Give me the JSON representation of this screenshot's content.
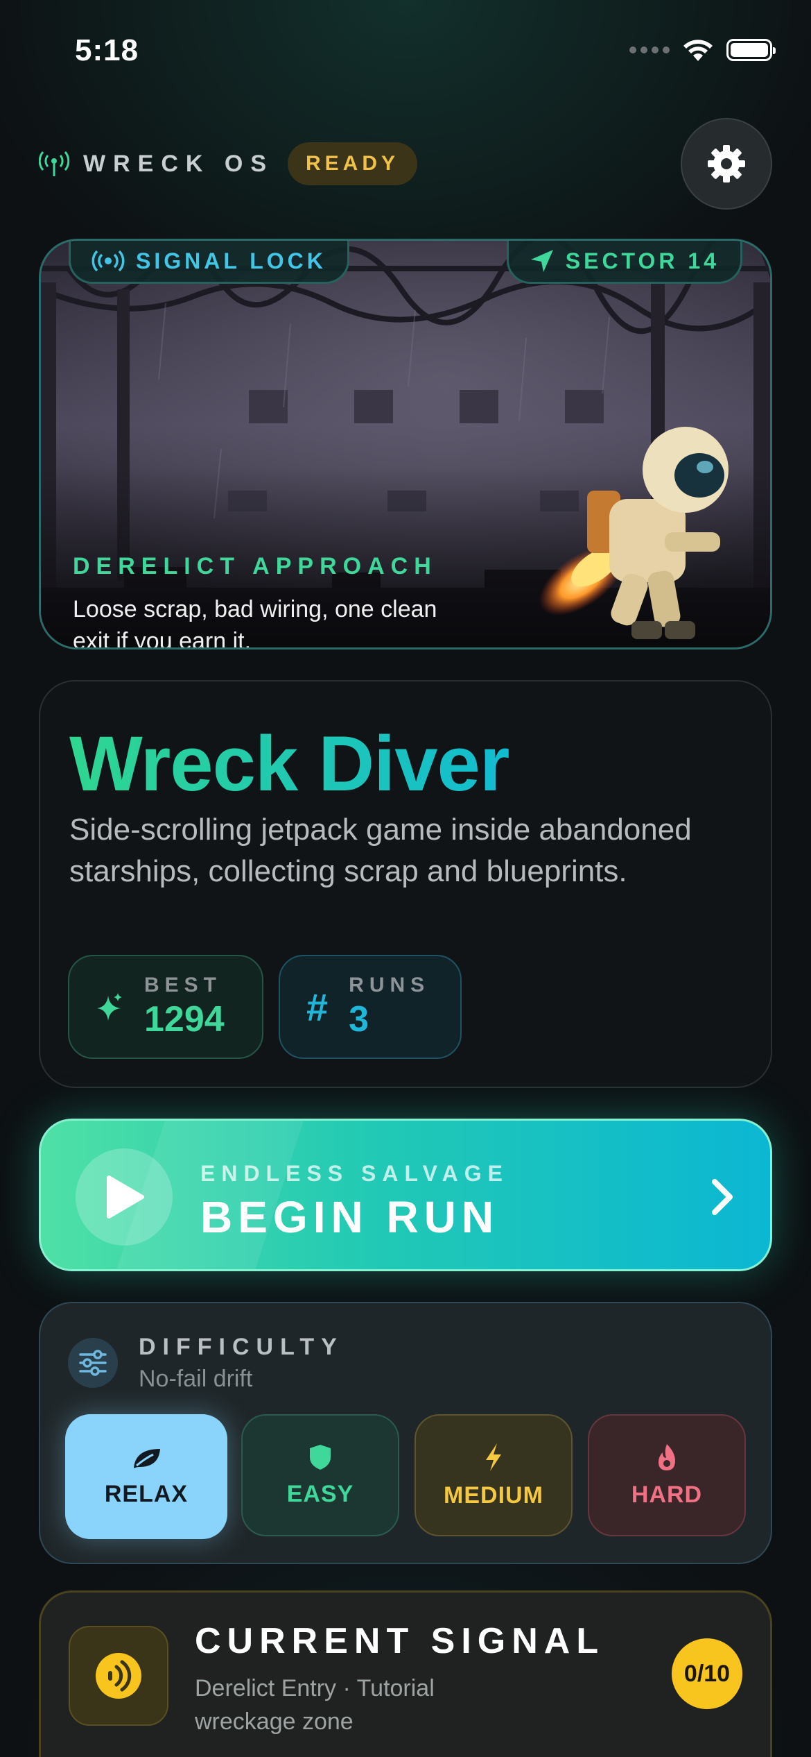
{
  "status_bar": {
    "time": "5:18"
  },
  "header": {
    "app_name": "WRECK OS",
    "status_badge": "READY"
  },
  "hero": {
    "signal_chip": "SIGNAL LOCK",
    "sector_chip": "SECTOR 14",
    "eyebrow": "DERELICT APPROACH",
    "description": "Loose scrap, bad wiring, one clean exit if you earn it."
  },
  "game": {
    "title": "Wreck Diver",
    "subtitle": "Side-scrolling jetpack game inside abandoned starships, collecting scrap and blueprints.",
    "stats": [
      {
        "label": "BEST",
        "value": "1294"
      },
      {
        "label": "RUNS",
        "value": "3"
      }
    ]
  },
  "run_button": {
    "eyebrow": "ENDLESS SALVAGE",
    "label": "BEGIN RUN"
  },
  "difficulty": {
    "label": "DIFFICULTY",
    "subtitle": "No-fail drift",
    "options": [
      "RELAX",
      "EASY",
      "MEDIUM",
      "HARD"
    ],
    "selected": "RELAX"
  },
  "current_signal": {
    "title": "CURRENT SIGNAL",
    "subtitle": "Derelict Entry · Tutorial wreckage zone",
    "progress": "0/10"
  },
  "colors": {
    "accent_green": "#3fd79a",
    "accent_cyan": "#12bcd1",
    "ready_gold": "#f0c24a",
    "relax_blue": "#8ad3fb",
    "hard_red": "#f07184",
    "signal_yellow": "#f7c51e"
  },
  "icons": [
    "antenna-icon",
    "gear-icon",
    "broadcast-icon",
    "navigation-arrow-icon",
    "sparkle-icon",
    "hash-icon",
    "play-icon",
    "chevron-right-icon",
    "sliders-icon",
    "leaf-icon",
    "shield-icon",
    "bolt-icon",
    "flame-icon",
    "signal-waves-icon"
  ]
}
